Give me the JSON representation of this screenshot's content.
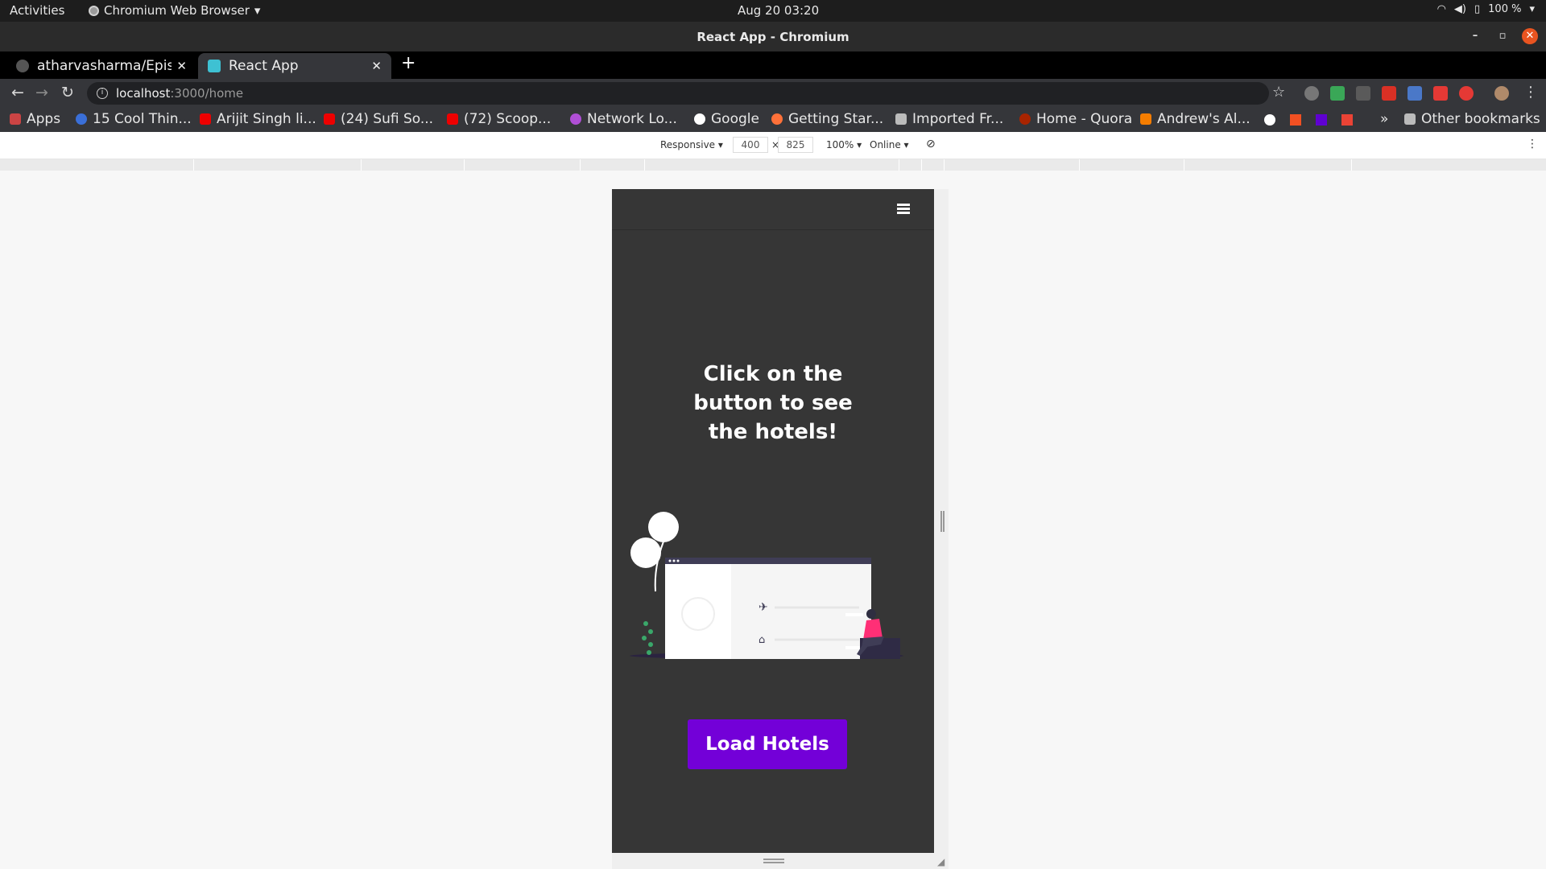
{
  "system_bar": {
    "activities": "Activities",
    "app_name": "Chromium Web Browser",
    "clock": "Aug 20  03:20",
    "battery": "100 %"
  },
  "window": {
    "title": "React App - Chromium"
  },
  "tabs": [
    {
      "label": "atharvasharma/Episou",
      "active": false
    },
    {
      "label": "React App",
      "active": true
    }
  ],
  "address_bar": {
    "host": "localhost",
    "path": ":3000/home"
  },
  "bookmarks": [
    {
      "label": "Apps",
      "icon": "apps-grid-icon"
    },
    {
      "label": "15 Cool Thin...",
      "icon": "site-favicon"
    },
    {
      "label": "Arijit Singh li...",
      "icon": "youtube-icon"
    },
    {
      "label": "(24) Sufi So...",
      "icon": "youtube-icon"
    },
    {
      "label": "(72) Scoop...",
      "icon": "youtube-icon"
    },
    {
      "label": "Network Lo...",
      "icon": "umbrella-icon"
    },
    {
      "label": "Google",
      "icon": "google-icon"
    },
    {
      "label": "Getting Star...",
      "icon": "firefox-icon"
    },
    {
      "label": "Imported Fr...",
      "icon": "folder-icon"
    },
    {
      "label": "Home - Quora",
      "icon": "quora-icon"
    },
    {
      "label": "Andrew's Al...",
      "icon": "blogger-icon"
    },
    {
      "label": "»",
      "icon": "overflow-chevron"
    },
    {
      "label": "Other bookmarks",
      "icon": "folder-icon"
    }
  ],
  "devtools": {
    "device": "Responsive ▾",
    "width": "400",
    "times": "×",
    "height": "825",
    "zoom": "100% ▾",
    "network": "Online ▾"
  },
  "page": {
    "headline": "Click on the button to see the hotels!",
    "button_label": "Load Hotels",
    "accent_color": "#7300d8",
    "background_color": "#363636"
  }
}
